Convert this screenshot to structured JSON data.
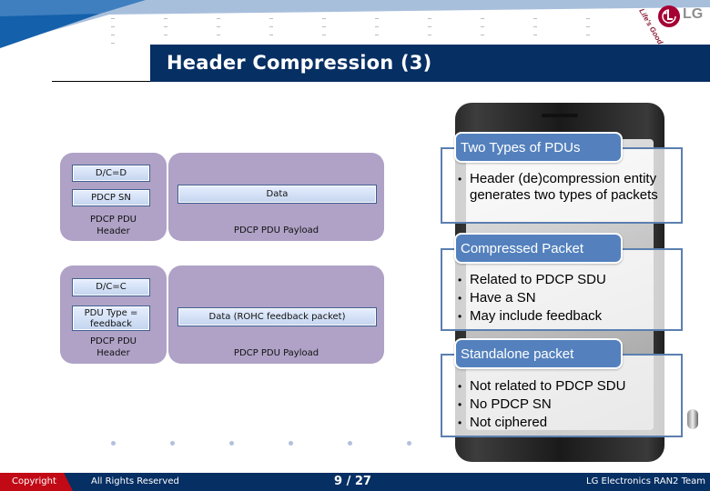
{
  "slide": {
    "title": "Header Compression (3)"
  },
  "logo": {
    "brand": "LG",
    "tagline": "Life's Good"
  },
  "diagram_data_pdu": {
    "fields": {
      "dc": "D/C=D",
      "sn": "PDCP SN",
      "payload": "Data"
    },
    "header_label": [
      "PDCP PDU",
      "Header"
    ],
    "payload_label": "PDCP PDU Payload"
  },
  "diagram_control_pdu": {
    "fields": {
      "dc": "D/C=C",
      "pdu_type": [
        "PDU Type =",
        "feedback"
      ],
      "payload": "Data (ROHC feedback packet)"
    },
    "header_label": [
      "PDCP PDU",
      "Header"
    ],
    "payload_label": "PDCP PDU Payload"
  },
  "callouts": [
    {
      "heading": "Two Types of PDUs",
      "bullets": [
        "Header (de)compression entity generates two types of packets"
      ]
    },
    {
      "heading": "Compressed Packet",
      "bullets": [
        "Related to PDCP SDU",
        "Have a SN",
        "May include feedback"
      ]
    },
    {
      "heading": "Standalone packet",
      "bullets": [
        "Not related to PDCP SDU",
        "No PDCP SN",
        "Not ciphered"
      ]
    }
  ],
  "footer": {
    "copyright": "Copyright",
    "rights": "All Rights Reserved",
    "page": "9 / 27",
    "team": "LG Electronics RAN2 Team"
  },
  "colors": {
    "title_bar": "#062f63",
    "callout_head": "#5481bd",
    "callout_border": "#5b7fb0",
    "panel": "#afa2c6",
    "footer_red": "#c20a16"
  }
}
